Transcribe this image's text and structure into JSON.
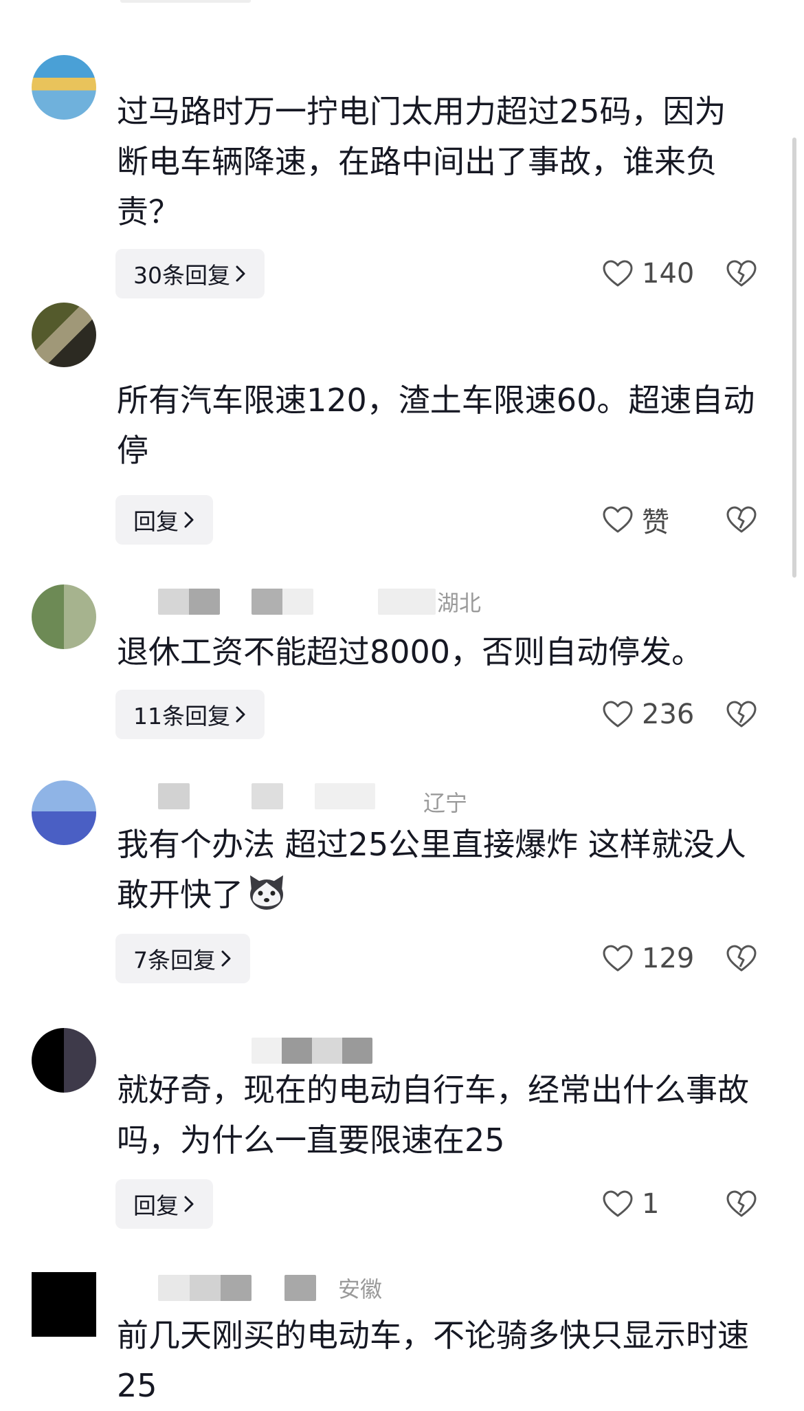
{
  "comments": [
    {
      "location": "",
      "text": "过马路时万一拧电门太用力超过25码，因为断电车辆降速，在路中间出了事故，谁来负责？",
      "reply_label": "30条回复",
      "likes": "140"
    },
    {
      "location": "",
      "text": "所有汽车限速120，渣土车限速60。超速自动停",
      "reply_label": "回复",
      "likes": "赞"
    },
    {
      "location": "湖北",
      "text": "退休工资不能超过8000，否则自动停发。",
      "reply_label": "11条回复",
      "likes": "236"
    },
    {
      "location": "辽宁",
      "text": "我有个办法 超过25公里直接爆炸 这样就没人敢开快了",
      "emoji": "husky-emoji",
      "reply_label": "7条回复",
      "likes": "129"
    },
    {
      "location": "",
      "text": "就好奇，现在的电动自行车，经常出什么事故吗，为什么一直要限速在25",
      "reply_label": "回复",
      "likes": "1"
    },
    {
      "location": "安徽",
      "text": "前几天刚买的电动车，不论骑多快只显示时速25"
    }
  ],
  "icons": {
    "like": "heart-outline-icon",
    "dislike": "broken-heart-icon",
    "reply_chevron": "chevron-right-icon"
  },
  "colors": {
    "text": "#161823",
    "secondary": "#9a9a9a",
    "reply_bg": "#f2f2f4"
  }
}
